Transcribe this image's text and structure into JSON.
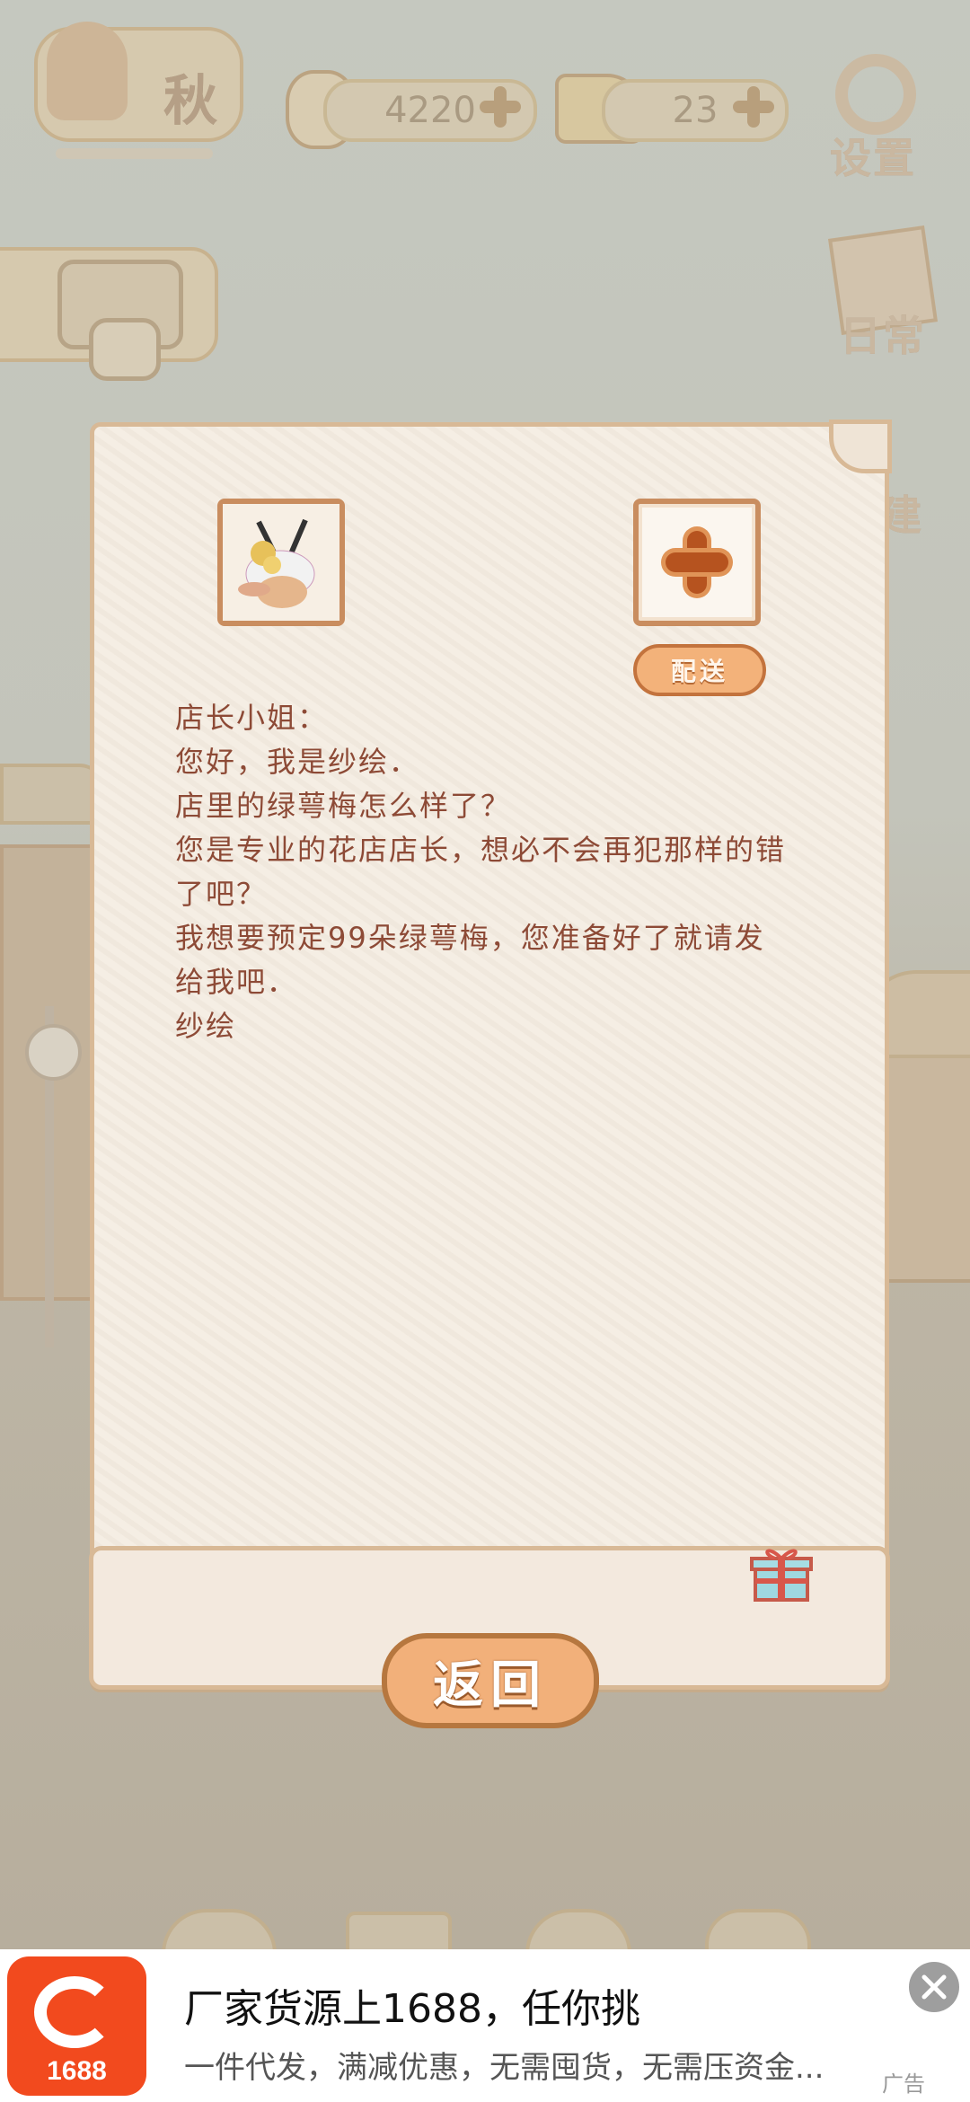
{
  "hud": {
    "season_label": "秋",
    "fish_count": "4220",
    "cheese_count": "23",
    "settings_label": "设置",
    "daily_label": "日常",
    "build_label": "建"
  },
  "letter": {
    "deliver_label": "配送",
    "lines": [
      "店长小姐：",
      "您好，我是纱绘．",
      "店里的绿萼梅怎么样了？",
      "您是专业的花店店长，想必不会再犯那样的错",
      "了吧？",
      "我想要预定99朵绿萼梅，您准备好了就请发",
      "给我吧．",
      "纱绘"
    ],
    "return_label": "返回"
  },
  "ad": {
    "logo_text": "1688",
    "title": "厂家货源上1688，任你挑",
    "description": "一件代发，满减优惠，无需囤货，无需压资金...",
    "tag": "广告"
  },
  "colors": {
    "accent_orange": "#f2b07a",
    "letter_text": "#8d4a36",
    "ad_brand": "#f24a1e"
  }
}
